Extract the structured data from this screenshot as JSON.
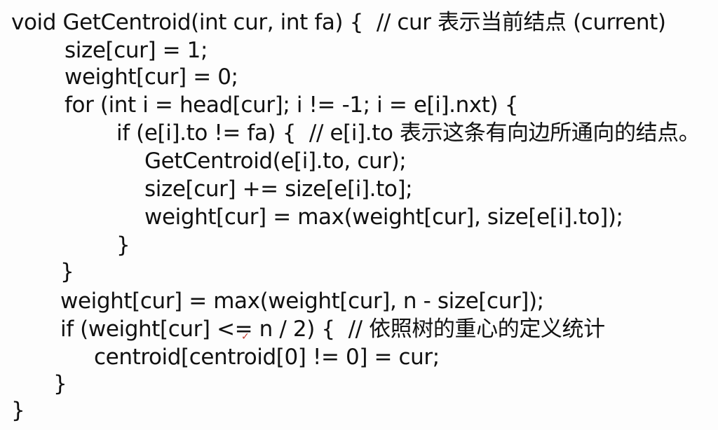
{
  "code": {
    "lines": [
      "void GetCentroid(int cur, int fa) {  // cur 表示当前结点 (current)",
      "size[cur] = 1;",
      "weight[cur] = 0;",
      "for (int i = head[cur]; i != -1; i = e[i].nxt) {",
      "if (e[i].to != fa) {  // e[i].to 表示这条有向边所通向的结点。",
      "GetCentroid(e[i].to, cur);",
      "size[cur] += size[e[i].to];",
      "weight[cur] = max(weight[cur], size[e[i].to]);",
      "}",
      "}",
      "weight[cur] = max(weight[cur], n - size[cur]);",
      "if (weight[cur] <= n / 2) {  // 依照树的重心的定义统计",
      "centroid[centroid[0] != 0] = cur;",
      "}",
      "}"
    ]
  },
  "annotation": {
    "pen_mark": "✓"
  }
}
